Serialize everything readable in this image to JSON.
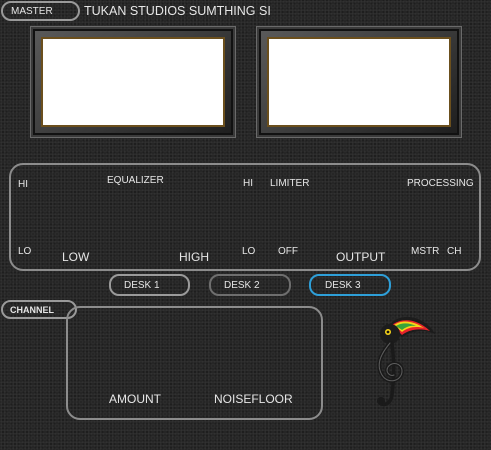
{
  "header": {
    "master_label": "MASTER",
    "title": "TUKAN STUDIOS SUMTHING SI"
  },
  "equalizer": {
    "hi": "HI",
    "lo": "LO",
    "title": "EQUALIZER",
    "low": "LOW",
    "high": "HIGH"
  },
  "limiter": {
    "hi": "HI",
    "lo": "LO",
    "title": "LIMITER",
    "off": "OFF"
  },
  "output": {
    "label": "OUTPUT"
  },
  "processing": {
    "title": "PROCESSING",
    "mstr": "MSTR",
    "ch": "CH"
  },
  "desks": [
    {
      "label": "DESK 1",
      "active": false
    },
    {
      "label": "DESK 2",
      "active": false
    },
    {
      "label": "DESK 3",
      "active": true
    }
  ],
  "channel": {
    "label": "CHANNEL",
    "amount": "AMOUNT",
    "noisefloor": "NOISEFLOOR"
  },
  "colors": {
    "accent_active": "#2e9fd8",
    "border": "#9a9a9a",
    "meter_frame": "#6b4f1d"
  },
  "logo": {
    "icon": "toucan-treble-clef-icon"
  }
}
